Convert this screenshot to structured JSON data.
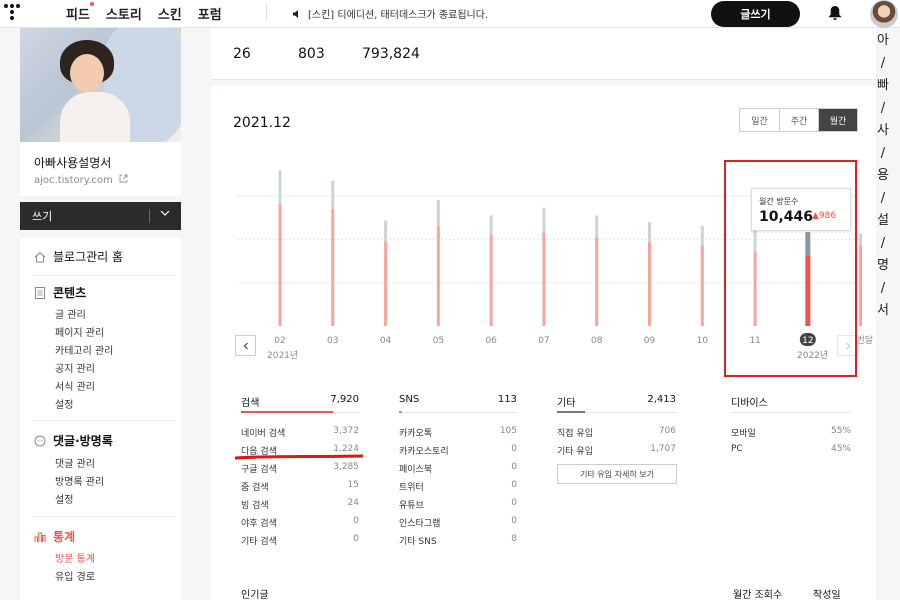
{
  "topbar": {
    "nav": [
      "피드",
      "스토리",
      "스킨",
      "포럼"
    ],
    "notice": "[스킨] 티에디션, 태터데스크가 종료됩니다.",
    "write_button": "글쓰기"
  },
  "vertical_text": [
    "아",
    "빠",
    "사",
    "용",
    "설",
    "명",
    "서"
  ],
  "profile": {
    "blog_name": "아빠사용설명서",
    "blog_url": "ajoc.tistory.com"
  },
  "write_menu": {
    "label": "쓰기"
  },
  "sidebar": {
    "home": "블로그관리 홈",
    "content": {
      "title": "콘텐츠",
      "items": [
        "글 관리",
        "페이지 관리",
        "카테고리 관리",
        "공지 관리",
        "서식 관리",
        "설정"
      ]
    },
    "comments": {
      "title": "댓글·방명록",
      "items": [
        "댓글 관리",
        "방명록 관리",
        "설정"
      ]
    },
    "stats": {
      "title": "통계",
      "items": [
        "방문 통계",
        "유입 경로"
      ]
    }
  },
  "top_stats": [
    "26",
    "803",
    "793,824"
  ],
  "main": {
    "period": "2021.12",
    "segments": [
      "일간",
      "주간",
      "월간"
    ],
    "active_segment": "월간",
    "year_start": "2021년",
    "year_end": "2022년",
    "tooltip": {
      "label": "월간 방문수",
      "value": "10,446",
      "change": "986"
    }
  },
  "chart_data": {
    "type": "bar",
    "categories": [
      "02",
      "03",
      "04",
      "05",
      "06",
      "07",
      "08",
      "09",
      "10",
      "11",
      "12",
      "이번달"
    ],
    "highlighted_category": "12",
    "series": [
      {
        "values": [
          9500,
          9100,
          6600,
          7800,
          7100,
          7300,
          6900,
          6500,
          6300,
          5800,
          5500,
          6300
        ]
      },
      {
        "values": [
          2600,
          2200,
          1600,
          2000,
          1500,
          1900,
          1700,
          1600,
          1500,
          1700,
          1800,
          900
        ]
      }
    ],
    "colors": {
      "primary": "#f4a69d",
      "secondary": "#cdd3da",
      "highlight_primary": "#f0554a",
      "highlight_secondary": "#8b96a2"
    },
    "ylim": [
      0,
      14000
    ],
    "grid": true
  },
  "search": {
    "title": "검색",
    "total": "7,920",
    "rows": [
      {
        "label": "네이버 검색",
        "value": "3,372"
      },
      {
        "label": "다음 검색",
        "value": "1,224"
      },
      {
        "label": "구글 검색",
        "value": "3,285"
      },
      {
        "label": "줌 검색",
        "value": "15"
      },
      {
        "label": "빙 검색",
        "value": "24"
      },
      {
        "label": "야후 검색",
        "value": "0"
      },
      {
        "label": "기타 검색",
        "value": "0"
      }
    ]
  },
  "sns": {
    "title": "SNS",
    "total": "113",
    "rows": [
      {
        "label": "카카오톡",
        "value": "105"
      },
      {
        "label": "카카오스토리",
        "value": "0"
      },
      {
        "label": "페이스북",
        "value": "0"
      },
      {
        "label": "트위터",
        "value": "0"
      },
      {
        "label": "유튜브",
        "value": "0"
      },
      {
        "label": "인스타그램",
        "value": "0"
      },
      {
        "label": "기타 SNS",
        "value": "8"
      }
    ]
  },
  "etc": {
    "title": "기타",
    "total": "2,413",
    "rows": [
      {
        "label": "직접 유입",
        "value": "706"
      },
      {
        "label": "기타 유입",
        "value": "1,707"
      }
    ],
    "detail_button": "기타 유입 자세히 보기"
  },
  "device": {
    "title": "디바이스",
    "rows": [
      {
        "label": "모바일",
        "value": "55%"
      },
      {
        "label": "PC",
        "value": "45%"
      }
    ]
  },
  "popular": {
    "title": "인기글",
    "col_views": "월간 조회수",
    "col_date": "작성일"
  }
}
